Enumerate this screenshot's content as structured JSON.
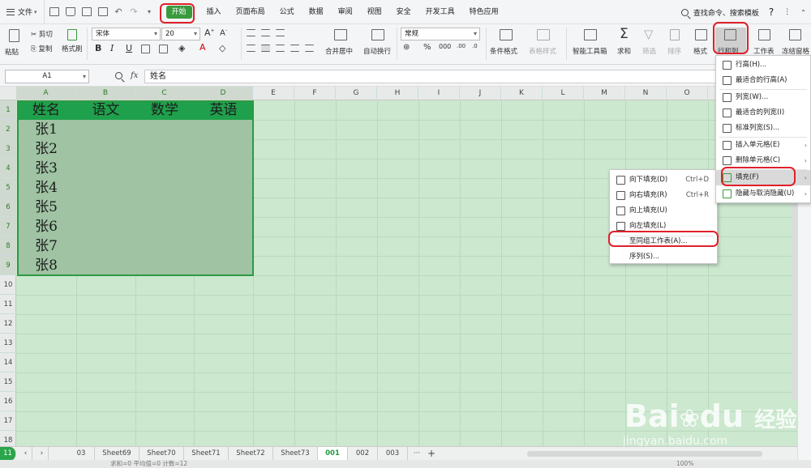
{
  "menubar": {
    "file_label": "文件",
    "tabs": [
      "开始",
      "插入",
      "页面布局",
      "公式",
      "数据",
      "审阅",
      "视图",
      "安全",
      "开发工具",
      "特色应用"
    ],
    "search_label": "查找命令、搜索模板",
    "help_label": "?"
  },
  "ribbon": {
    "paste": "粘贴",
    "cut": "剪切",
    "copy": "复制",
    "format_painter": "格式刷",
    "font_name": "宋体",
    "font_size": "20",
    "bold": "B",
    "italic": "I",
    "underline": "U",
    "merge_center": "合并居中",
    "wrap_text": "自动换行",
    "number_format": "常规",
    "percent": "%",
    "conditional_format": "条件格式",
    "table_style": "表格样式",
    "smart_toolbox": "智能工具箱",
    "sum": "求和",
    "filter": "筛选",
    "sort": "排序",
    "format": "格式",
    "row_col": "行和列",
    "worksheet": "工作表",
    "freeze": "冻结窗格"
  },
  "formula_bar": {
    "name_box": "A1",
    "fx": "fx",
    "content": "姓名"
  },
  "grid": {
    "columns": [
      "A",
      "B",
      "C",
      "D",
      "E",
      "F",
      "G",
      "H",
      "I",
      "J",
      "K",
      "L",
      "M",
      "N",
      "O"
    ],
    "rows": [
      "1",
      "2",
      "3",
      "4",
      "5",
      "6",
      "7",
      "8",
      "9",
      "10",
      "11",
      "12",
      "13",
      "14",
      "15",
      "16",
      "17",
      "18"
    ],
    "headers": [
      "姓名",
      "语文",
      "数学",
      "英语"
    ],
    "names": [
      "张1",
      "张2",
      "张3",
      "张4",
      "张5",
      "张6",
      "张7",
      "张8"
    ]
  },
  "row_col_menu": [
    "行高(H)...",
    "最适合的行高(A)",
    "列宽(W)...",
    "最适合的列宽(I)",
    "标准列宽(S)...",
    "插入单元格(E)",
    "删除单元格(C)",
    "填充(F)",
    "隐藏与取消隐藏(U)"
  ],
  "fill_menu": [
    {
      "label": "向下填充(D)",
      "shortcut": "Ctrl+D"
    },
    {
      "label": "向右填充(R)",
      "shortcut": "Ctrl+R"
    },
    {
      "label": "向上填充(U)",
      "shortcut": ""
    },
    {
      "label": "向左填充(L)",
      "shortcut": ""
    },
    {
      "label": "至同组工作表(A)...",
      "shortcut": ""
    },
    {
      "label": "序列(S)...",
      "shortcut": ""
    }
  ],
  "sheets": [
    "03",
    "Sheet69",
    "Sheet70",
    "Sheet71",
    "Sheet72",
    "Sheet73",
    "001",
    "002",
    "003"
  ],
  "active_sheet": "001",
  "status": {
    "text": "求和=0  平均值=0  计数=12",
    "zoom": "100%"
  },
  "watermark": {
    "brand": "Bai",
    "brand2": "du",
    "cn": "经验",
    "url": "jingyan.baidu.com"
  },
  "colors": {
    "accent": "#3a9a3e",
    "highlight": "#e0202a",
    "grid_bg": "#cce8cf"
  }
}
